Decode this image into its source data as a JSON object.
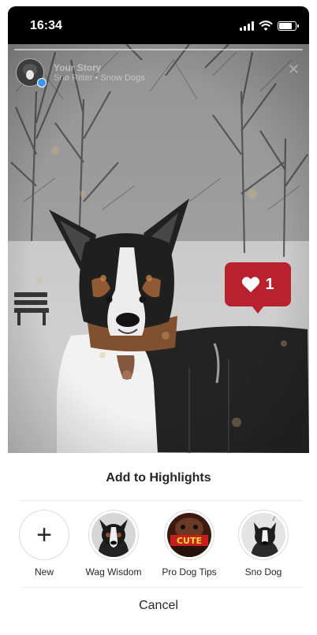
{
  "status_bar": {
    "time": "16:34"
  },
  "story": {
    "owner": "Your Story",
    "subtitle": "Snø Ritter • Snow Dogs",
    "likes": "1"
  },
  "sheet": {
    "title": "Add to Highlights",
    "new_label": "New",
    "highlights": [
      {
        "label": "Wag Wisdom",
        "icon": "dog-portrait"
      },
      {
        "label": "Pro Dog Tips",
        "icon": "cute-dog-cover"
      },
      {
        "label": "Sno Dog",
        "icon": "dog-in-snow"
      }
    ],
    "cancel_label": "Cancel"
  },
  "colors": {
    "like_bubble": "#b8212d",
    "story_badge": "#3897f0",
    "text": "#262626",
    "divider": "#ececec"
  }
}
